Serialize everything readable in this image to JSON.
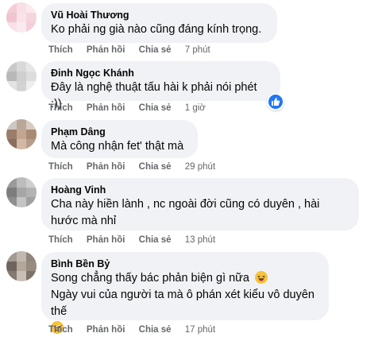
{
  "actions": {
    "like": "Thích",
    "reply": "Phản hồi",
    "share": "Chia sẻ"
  },
  "colors": {
    "bubble": "#f0f2f5",
    "meta": "#65676b",
    "like_blue": "#2078f4"
  },
  "comments": [
    {
      "author": "Vũ Hoài Thương",
      "lines": [
        "Ko phải ng già nào cũng đáng kính trọng."
      ],
      "time": "7 phút",
      "reactions": 0
    },
    {
      "author": "Đinh Ngọc Khánh",
      "lines": [
        "Đây là nghệ thuật tấu hài k phải nói phét :))"
      ],
      "time": "1 giờ",
      "reactions": 1,
      "reaction_icon": "like-icon"
    },
    {
      "author": "Phạm Dâng",
      "lines": [
        "Mà công nhận fet' thật mà"
      ],
      "time": "29 phút",
      "reactions": 0
    },
    {
      "author": "Hoàng Vinh",
      "lines": [
        "Cha này hiền lành , nc ngoài đời cũng có duyên , hài",
        "hước mà nhỉ"
      ],
      "time": "13 phút",
      "reactions": 0
    },
    {
      "author": "Bình Bền Bỷ",
      "lines": [
        "Song chẳng thấy bác phản biện gì nữa",
        "Ngày vui của người ta mà ô phán xét kiểu vô duyên thế"
      ],
      "time": "17 phút",
      "reactions": 0,
      "inline_emojis": [
        "laughing-emoji-icon",
        "pleading-emoji-icon"
      ]
    }
  ]
}
